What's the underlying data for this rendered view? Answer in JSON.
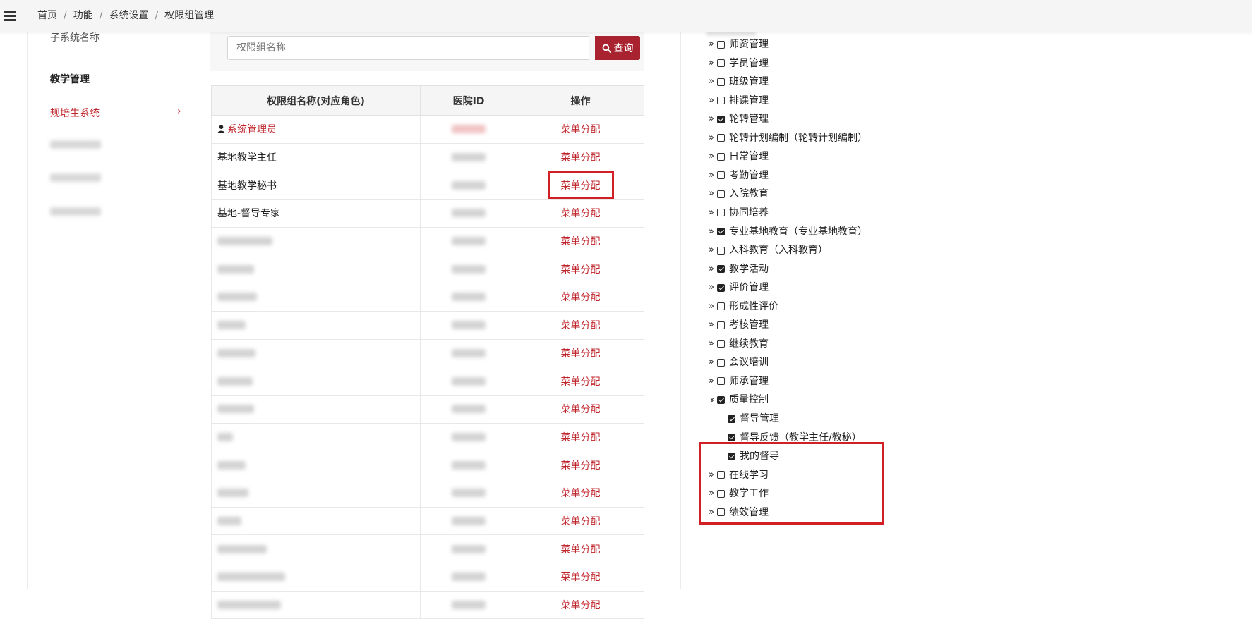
{
  "breadcrumb": {
    "items": [
      "首页",
      "功能",
      "系统设置",
      "权限组管理"
    ],
    "separator": "/"
  },
  "sidebar": {
    "header": "子系统名称",
    "group_label": "教学管理",
    "active_item": "规培生系统",
    "active_chevron": "›"
  },
  "search": {
    "placeholder": "权限组名称",
    "button_label": "查询",
    "button_icon": "search-icon"
  },
  "table": {
    "columns": [
      "权限组名称(对应角色)",
      "医院ID",
      "操作"
    ],
    "action_label": "菜单分配",
    "rows": [
      {
        "name": "系统管理员",
        "is_admin": true
      },
      {
        "name": "基地教学主任"
      },
      {
        "name": "基地教学秘书",
        "highlight": true
      },
      {
        "name": "基地-督导专家"
      }
    ],
    "blurred_rows": 14
  },
  "tree": {
    "items": [
      {
        "label": "师资管理",
        "checked": false
      },
      {
        "label": "学员管理",
        "checked": false
      },
      {
        "label": "班级管理",
        "checked": false
      },
      {
        "label": "排课管理",
        "checked": false
      },
      {
        "label": "轮转管理",
        "checked": true
      },
      {
        "label": "轮转计划编制（轮转计划编制）",
        "checked": false
      },
      {
        "label": "日常管理",
        "checked": false
      },
      {
        "label": "考勤管理",
        "checked": false
      },
      {
        "label": "入院教育",
        "checked": false
      },
      {
        "label": "协同培养",
        "checked": false
      },
      {
        "label": "专业基地教育（专业基地教育）",
        "checked": true
      },
      {
        "label": "入科教育（入科教育）",
        "checked": false
      },
      {
        "label": "教学活动",
        "checked": true
      },
      {
        "label": "评价管理",
        "checked": true
      },
      {
        "label": "形成性评价",
        "checked": false
      },
      {
        "label": "考核管理",
        "checked": false
      },
      {
        "label": "继续教育",
        "checked": false
      },
      {
        "label": "会议培训",
        "checked": false
      },
      {
        "label": "师承管理",
        "checked": false
      },
      {
        "label": "质量控制",
        "checked": true,
        "expanded": true
      },
      {
        "label": "督导管理",
        "checked": true,
        "child": true
      },
      {
        "label": "督导反馈（教学主任/教秘）",
        "checked": true,
        "child": true
      },
      {
        "label": "我的督导",
        "checked": true,
        "child": true
      },
      {
        "label": "在线学习",
        "checked": false
      },
      {
        "label": "教学工作",
        "checked": false
      },
      {
        "label": "绩效管理",
        "checked": false
      }
    ]
  },
  "colors": {
    "accent": "#c0272d",
    "button_bg": "#a8232f",
    "highlight_border": "#d21f26"
  }
}
